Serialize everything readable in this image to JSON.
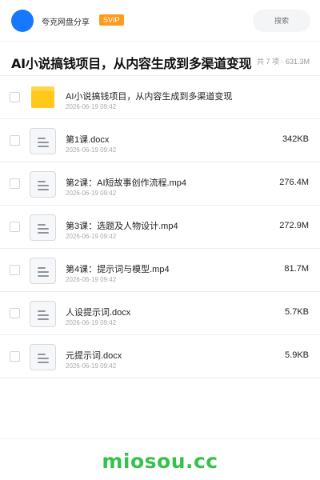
{
  "header": {
    "app_name": "夸克网盘分享",
    "badge": "SVIP",
    "search_placeholder": "搜索",
    "avatar_color": "#1677ff",
    "badge_color": "#ff9a1f"
  },
  "folder": {
    "title": "AI小说搞钱项目，从内容生成到多渠道变现",
    "summary": "共 7 项 · 631.3M"
  },
  "files": [
    {
      "icon": "folder-icon",
      "name": "AI小说搞钱项目，从内容生成到多渠道变现",
      "date": "2026-06-19 09:42",
      "size": ""
    },
    {
      "icon": "document-icon",
      "name": "第1课.docx",
      "date": "2026-06-19 09:42",
      "size": "342KB"
    },
    {
      "icon": "document-icon",
      "name": "第2课：AI短故事创作流程.mp4",
      "date": "2026-06-19 09:42",
      "size": "276.4M"
    },
    {
      "icon": "document-icon",
      "name": "第3课：选题及人物设计.mp4",
      "date": "2026-06-19 09:42",
      "size": "272.9M"
    },
    {
      "icon": "document-icon",
      "name": "第4课：提示词与模型.mp4",
      "date": "2026-06-19 09:42",
      "size": "81.7M"
    },
    {
      "icon": "document-icon",
      "name": "人设提示词.docx",
      "date": "2026-06-19 09:42",
      "size": "5.7KB"
    },
    {
      "icon": "document-icon",
      "name": "元提示词.docx",
      "date": "2026-06-19 09:42",
      "size": "5.9KB"
    }
  ],
  "watermark": {
    "text": "miosou.cc",
    "color": "#35c24a"
  }
}
